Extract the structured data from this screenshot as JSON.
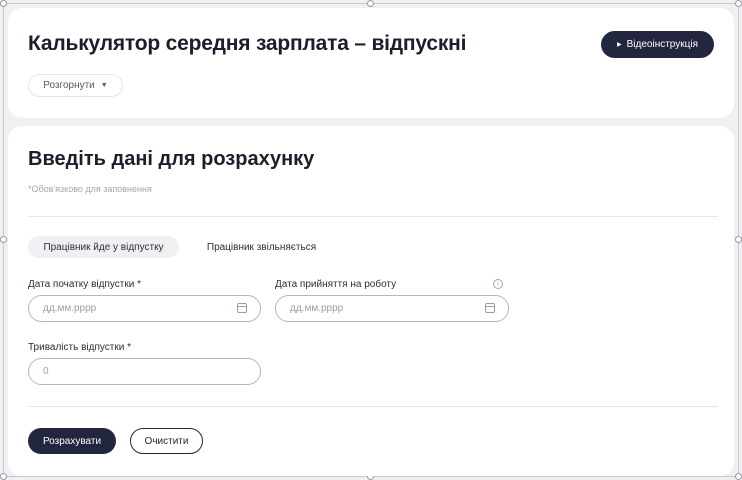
{
  "header": {
    "title": "Калькулятор середня зарплата – відпускні",
    "video_button_label": "Відеоінструкція",
    "expand_label": "Розгорнути"
  },
  "form": {
    "title": "Введіть дані для розрахунку",
    "required_note": "*Обов'язково для заповнення",
    "tabs": [
      {
        "label": "Працівник йде у відпустку",
        "active": true
      },
      {
        "label": "Працівник звільняється",
        "active": false
      }
    ],
    "fields": {
      "vacation_start": {
        "label": "Дата початку відпустки *",
        "placeholder": "дд.мм.рррр"
      },
      "hire_date": {
        "label": "Дата прийняття на роботу",
        "placeholder": "дд.мм.рррр"
      },
      "vacation_duration": {
        "label": "Тривалість відпустки *",
        "placeholder": "0"
      }
    },
    "calculate_label": "Розрахувати",
    "clear_label": "Очистити"
  },
  "colors": {
    "primary": "#23263f",
    "background": "#f0f0f2",
    "card": "#ffffff"
  },
  "icons": [
    "play-icon",
    "caret-down-icon",
    "info-icon",
    "calendar-icon"
  ]
}
